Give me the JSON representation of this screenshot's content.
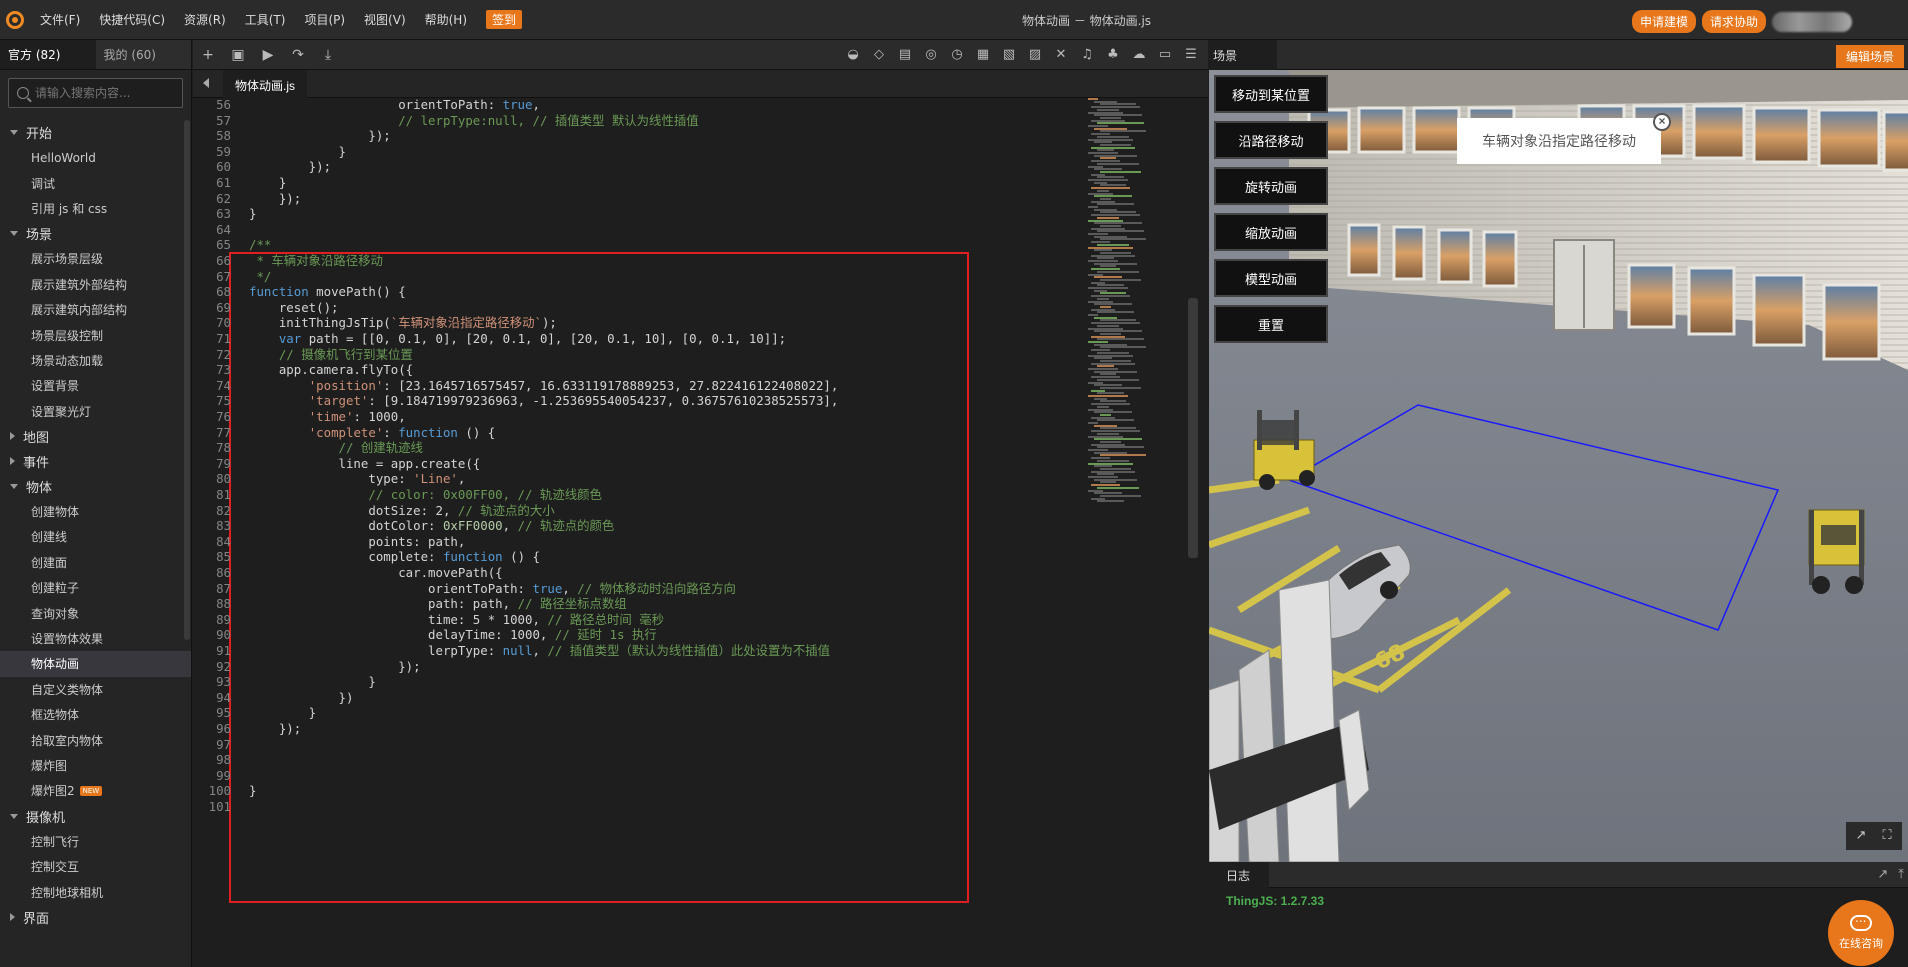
{
  "menu": {
    "items": [
      "文件(F)",
      "快捷代码(C)",
      "资源(R)",
      "工具(T)",
      "项目(P)",
      "视图(V)",
      "帮助(H)"
    ],
    "badge": "签到"
  },
  "window_title": "物体动画 －  物体动画.js",
  "top_right": {
    "apply_modeling": "申请建模",
    "request_help": "请求协助"
  },
  "sidebar": {
    "tabs": [
      "官方 (82)",
      "我的 (60)"
    ],
    "search_placeholder": "请输入搜索内容...",
    "groups": [
      {
        "label": "开始",
        "expanded": true,
        "items": [
          "HelloWorld",
          "调试",
          "引用 js 和 css"
        ]
      },
      {
        "label": "场景",
        "expanded": true,
        "items": [
          "展示场景层级",
          "展示建筑外部结构",
          "展示建筑内部结构",
          "场景层级控制",
          "场景动态加载",
          "设置背景",
          "设置聚光灯"
        ]
      },
      {
        "label": "地图",
        "expanded": false,
        "items": []
      },
      {
        "label": "事件",
        "expanded": false,
        "items": []
      },
      {
        "label": "物体",
        "expanded": true,
        "items": [
          "创建物体",
          "创建线",
          "创建面",
          "创建粒子",
          "查询对象",
          "设置物体效果",
          "物体动画",
          "自定义类物体",
          "框选物体",
          "拾取室内物体",
          "爆炸图",
          "爆炸图2"
        ]
      },
      {
        "label": "摄像机",
        "expanded": true,
        "items": [
          "控制飞行",
          "控制交互",
          "控制地球相机"
        ]
      },
      {
        "label": "界面",
        "expanded": false,
        "items": []
      }
    ],
    "active_item": "物体动画",
    "new_badge": "NEW"
  },
  "editor": {
    "file_tab": "物体动画.js",
    "lines": [
      {
        "n": "56",
        "t": "                    orientToPath: true,"
      },
      {
        "n": "57",
        "t": "                    // lerpType:null, // 插值类型 默认为线性插值"
      },
      {
        "n": "58",
        "t": "                });"
      },
      {
        "n": "59",
        "t": "            }"
      },
      {
        "n": "60",
        "t": "        });"
      },
      {
        "n": "61",
        "t": "    }"
      },
      {
        "n": "62",
        "t": "    });"
      },
      {
        "n": "63",
        "t": "}"
      },
      {
        "n": "64",
        "t": ""
      },
      {
        "n": "65",
        "t": "/**"
      },
      {
        "n": "66",
        "t": " * 车辆对象沿路径移动"
      },
      {
        "n": "67",
        "t": " */"
      },
      {
        "n": "68",
        "t": "function movePath() {"
      },
      {
        "n": "69",
        "t": "    reset();"
      },
      {
        "n": "70",
        "t": "    initThingJsTip(`车辆对象沿指定路径移动`);"
      },
      {
        "n": "71",
        "t": "    var path = [[0, 0.1, 0], [20, 0.1, 0], [20, 0.1, 10], [0, 0.1, 10]];"
      },
      {
        "n": "72",
        "t": "    // 摄像机飞行到某位置"
      },
      {
        "n": "73",
        "t": "    app.camera.flyTo({"
      },
      {
        "n": "74",
        "t": "        'position': [23.1645716575457, 16.633119178889253, 27.822416122408022],"
      },
      {
        "n": "75",
        "t": "        'target': [9.184719979236963, -1.253695540054237, 0.36757610238525573],"
      },
      {
        "n": "76",
        "t": "        'time': 1000,"
      },
      {
        "n": "77",
        "t": "        'complete': function () {"
      },
      {
        "n": "78",
        "t": "            // 创建轨迹线"
      },
      {
        "n": "79",
        "t": "            line = app.create({"
      },
      {
        "n": "80",
        "t": "                type: 'Line',"
      },
      {
        "n": "81",
        "t": "                // color: 0x00FF00, // 轨迹线颜色"
      },
      {
        "n": "82",
        "t": "                dotSize: 2, // 轨迹点的大小"
      },
      {
        "n": "83",
        "t": "                dotColor: 0xFF0000, // 轨迹点的颜色"
      },
      {
        "n": "84",
        "t": "                points: path,"
      },
      {
        "n": "85",
        "t": "                complete: function () {"
      },
      {
        "n": "86",
        "t": "                    car.movePath({"
      },
      {
        "n": "87",
        "t": "                        orientToPath: true, // 物体移动时沿向路径方向"
      },
      {
        "n": "88",
        "t": "                        path: path, // 路径坐标点数组"
      },
      {
        "n": "89",
        "t": "                        time: 5 * 1000, // 路径总时间 毫秒"
      },
      {
        "n": "90",
        "t": "                        delayTime: 1000, // 延时 1s 执行"
      },
      {
        "n": "91",
        "t": "                        lerpType: null, // 插值类型（默认为线性插值）此处设置为不插值"
      },
      {
        "n": "92",
        "t": "                    });"
      },
      {
        "n": "93",
        "t": "                }"
      },
      {
        "n": "94",
        "t": "            })"
      },
      {
        "n": "95",
        "t": "        }"
      },
      {
        "n": "96",
        "t": "    });"
      },
      {
        "n": "97",
        "t": ""
      },
      {
        "n": "98",
        "t": ""
      },
      {
        "n": "99",
        "t": ""
      },
      {
        "n": "100",
        "t": "}"
      },
      {
        "n": "101",
        "t": ""
      }
    ]
  },
  "scene": {
    "tab": "场景",
    "edit_button": "编辑场景",
    "buttons": [
      "移动到某位置",
      "沿路径移动",
      "旋转动画",
      "缩放动画",
      "模型动画",
      "重置"
    ],
    "tip": "车辆对象沿指定路径移动",
    "parking_number": "68"
  },
  "log": {
    "tab": "日志",
    "version": "ThingJS: 1.2.7.33"
  },
  "chat": {
    "label": "在线咨询"
  },
  "colors": {
    "accent": "#e8761a",
    "highlight_border": "#e02020",
    "path_line": "#1a1aff",
    "keyword": "#569cd6",
    "string": "#ce9178",
    "comment": "#6a9955",
    "number": "#b5cea8"
  }
}
